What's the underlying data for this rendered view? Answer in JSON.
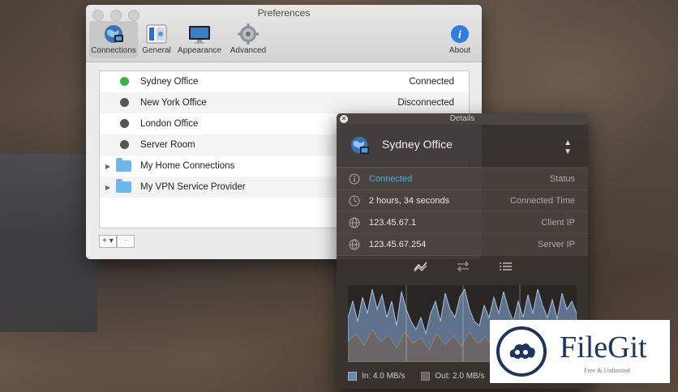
{
  "preferences": {
    "title": "Preferences",
    "toolbar": [
      {
        "label": "Connections",
        "icon": "globe-icon"
      },
      {
        "label": "General",
        "icon": "switch-icon"
      },
      {
        "label": "Appearance",
        "icon": "display-icon"
      },
      {
        "label": "Advanced",
        "icon": "gear-icon"
      }
    ],
    "about_label": "About",
    "connections": [
      {
        "name": "Sydney Office",
        "status": "Connected",
        "lock_color": "#37b34a"
      },
      {
        "name": "New York Office",
        "status": "Disconnected",
        "lock_color": "#555555"
      },
      {
        "name": "London Office",
        "status": "",
        "lock_color": "#555555"
      },
      {
        "name": "Server Room",
        "status": "",
        "lock_color": "#555555"
      }
    ],
    "groups": [
      {
        "name": "My Home Connections"
      },
      {
        "name": "My VPN Service Provider"
      }
    ],
    "add_label": "+ ▾",
    "remove_label": "−"
  },
  "details": {
    "title": "Details",
    "connection_name": "Sydney Office",
    "rows": [
      {
        "value": "Connected",
        "label": "Status",
        "icon": "info-icon"
      },
      {
        "value": "2 hours, 34 seconds",
        "label": "Connected Time",
        "icon": "clock-icon"
      },
      {
        "value": "123.45.67.1",
        "label": "Client IP",
        "icon": "globe-icon"
      },
      {
        "value": "123.45.67.254",
        "label": "Server IP",
        "icon": "globe-icon"
      }
    ],
    "legend": {
      "in": "In:  4.0 MB/s",
      "out": "Out:  2.0 MB/s"
    },
    "accent": "#41b4e6"
  },
  "watermark": {
    "name": "FileGit",
    "tagline": "Free & Unlimited"
  }
}
